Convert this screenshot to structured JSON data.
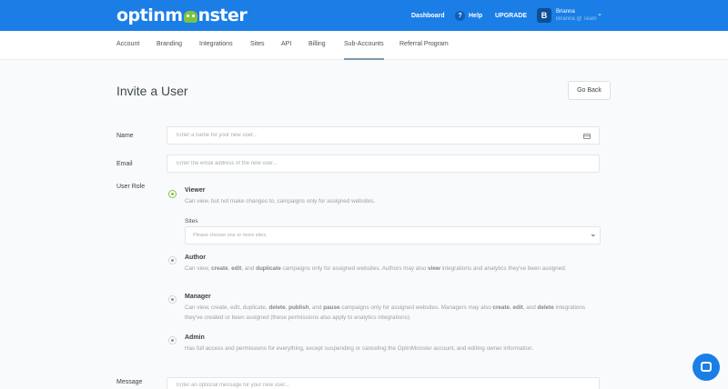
{
  "brand": {
    "logo_pre": "optinm",
    "logo_post": "nster",
    "accent": "#1a7ee6",
    "green": "#7fc241"
  },
  "topnav": {
    "dashboard": "Dashboard",
    "help_icon": "?",
    "help": "Help",
    "upgrade": "UPGRADE",
    "avatar_letter": "B",
    "user_name": "Brianna",
    "user_email": "Brianna @ Team",
    "chevron": "⌄"
  },
  "tabs": [
    {
      "label": "Account"
    },
    {
      "label": "Branding"
    },
    {
      "label": "Integrations"
    },
    {
      "label": "Sites"
    },
    {
      "label": "API"
    },
    {
      "label": "Billing"
    },
    {
      "label": "Sub-Accounts",
      "active": true
    },
    {
      "label": "Referral Program"
    }
  ],
  "page": {
    "title": "Invite a User",
    "go_back": "Go Back"
  },
  "form": {
    "name_label": "Name",
    "name_placeholder": "Enter a name for your new user...",
    "email_label": "Email",
    "email_placeholder": "Enter the email address of the new user...",
    "role_label": "User Role",
    "message_label": "Message",
    "message_placeholder": "Enter an optional message for your new user...",
    "sites_label": "Sites",
    "sites_placeholder": "Please choose one or more sites.",
    "roles": [
      {
        "title": "Viewer",
        "selected": true
      },
      {
        "title": "Author",
        "selected": false
      },
      {
        "title": "Manager",
        "selected": false
      },
      {
        "title": "Admin",
        "selected": false
      }
    ],
    "viewer_desc": "Can view, but not make changes to, campaigns only for assigned websites.",
    "author_desc": {
      "t1": "Can view, ",
      "b1": "create",
      "t2": ", ",
      "b2": "edit",
      "t3": ", and ",
      "b3": "duplicate",
      "t4": " campaigns only for assigned websites. Authors may also ",
      "b4": "view",
      "t5": " integrations and analytics they've been assigned."
    },
    "manager_desc": {
      "t1": "Can view, create, edit, duplicate, ",
      "b1": "delete",
      "t2": ", ",
      "b2": "publish",
      "t3": ", and ",
      "b3": "pause",
      "t4": " campaigns only for assigned websites. Managers may also ",
      "b4": "create",
      "t5": ", ",
      "b5": "edit",
      "t6": ", and ",
      "b6": "delete",
      "t7": " integrations they've created or been assigned (these permissions also apply to analytics integrations)."
    },
    "admin_desc": "Has full access and permissions for everything, except suspending or canceling the OptinMonster account, and editing owner information."
  }
}
